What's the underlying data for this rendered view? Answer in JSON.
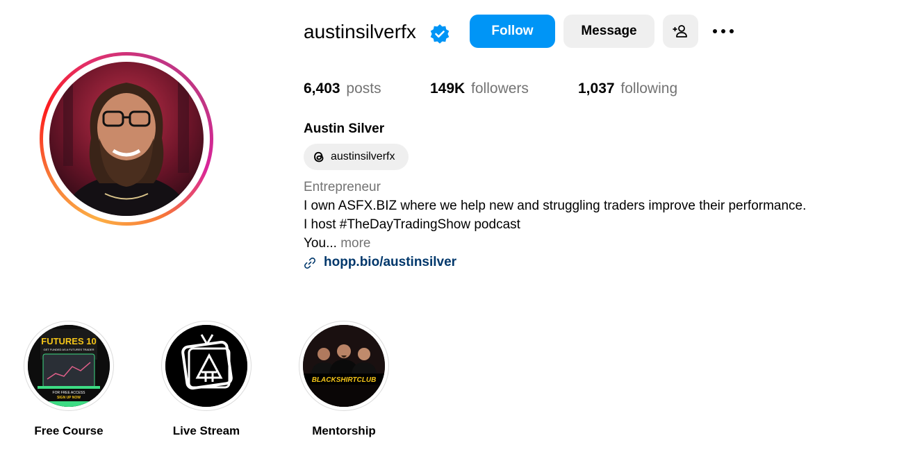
{
  "profile": {
    "username": "austinsilverfx",
    "full_name": "Austin Silver",
    "threads_handle": "austinsilverfx",
    "category": "Entrepreneur",
    "bio_lines": [
      "I own ASFX.BIZ where we help new and struggling traders improve their performance.",
      "I host #TheDayTradingShow podcast",
      "You..."
    ],
    "more_label": "more",
    "link": "hopp.bio/austinsilver"
  },
  "actions": {
    "follow_label": "Follow",
    "message_label": "Message"
  },
  "stats": [
    {
      "value": "6,403",
      "label": "posts"
    },
    {
      "value": "149K",
      "label": "followers"
    },
    {
      "value": "1,037",
      "label": "following"
    }
  ],
  "highlights": [
    {
      "label": "Free Course",
      "cover_text": [
        "FUTURES 10",
        "GET FUNDED AS A FUTURES TRADER",
        "FOR FREE ACCESS",
        "SIGN UP NOW"
      ]
    },
    {
      "label": "Live Stream"
    },
    {
      "label": "Mentorship",
      "cover_text": [
        "BLACKSHIRTCLUB"
      ]
    }
  ],
  "colors": {
    "primary_button": "#0095f6",
    "secondary_button": "#efefef",
    "muted_text": "#737373",
    "link_text": "#00376b",
    "verified_badge": "#0095f6"
  },
  "icons": [
    "verified-badge-icon",
    "add-user-icon",
    "more-options-icon",
    "threads-icon",
    "link-icon"
  ]
}
